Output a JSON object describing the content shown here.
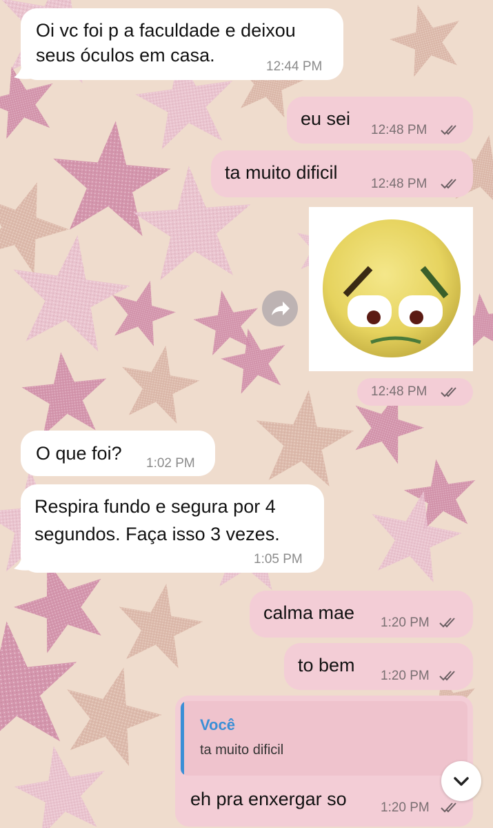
{
  "messages": [
    {
      "id": "m1",
      "direction": "in",
      "text": "Oi vc foi p a faculdade e deixou\nseus óculos em casa.",
      "time": "12:44 PM"
    },
    {
      "id": "m2",
      "direction": "out",
      "text": "eu sei",
      "time": "12:48 PM"
    },
    {
      "id": "m3",
      "direction": "out",
      "text": "ta muito dificil",
      "time": "12:48 PM"
    },
    {
      "id": "m4",
      "direction": "out",
      "type": "sticker",
      "sticker": "worried-face-sticker",
      "time": "12:48 PM"
    },
    {
      "id": "m5",
      "direction": "in",
      "text": "O que foi?",
      "time": "1:02 PM"
    },
    {
      "id": "m6",
      "direction": "in",
      "text": "Respira fundo e segura por 4\nsegundos. Faça isso 3 vezes.",
      "time": "1:05 PM"
    },
    {
      "id": "m7",
      "direction": "out",
      "text": "calma mae",
      "time": "1:20 PM"
    },
    {
      "id": "m8",
      "direction": "out",
      "text": "to bem",
      "time": "1:20 PM"
    },
    {
      "id": "m9",
      "direction": "out",
      "text": "eh pra enxergar so",
      "time": "1:20 PM",
      "reply": {
        "author": "Você",
        "quoted": "ta muito dificil"
      }
    }
  ],
  "icons": {
    "read_status": "double-check-icon",
    "forward": "forward-arrow-icon",
    "scroll_down": "chevron-down-icon"
  },
  "colors": {
    "incoming_bubble": "#ffffff",
    "outgoing_bubble": "#f3cdd6",
    "reply_accent": "#3a8fd6",
    "wallpaper": "#efdccd",
    "star_pink": "#cf8aa7",
    "star_rose": "#e9bfcf",
    "star_gold": "#d9b5a6"
  }
}
